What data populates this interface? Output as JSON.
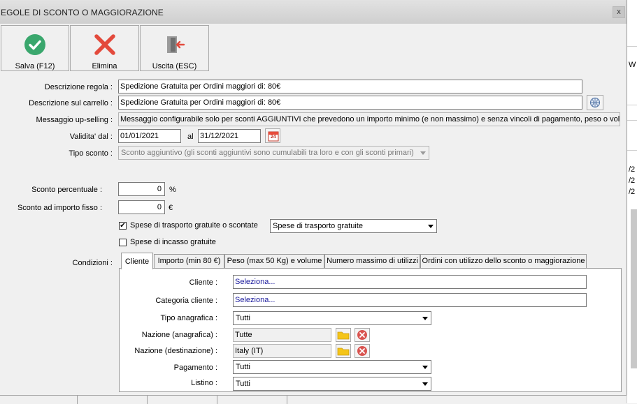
{
  "window": {
    "title": "EGOLE DI SCONTO O MAGGIORAZIONE",
    "close_label": "x"
  },
  "toolbar": {
    "save_label": "Salva (F12)",
    "delete_label": "Elimina",
    "exit_label": "Uscita (ESC)"
  },
  "form": {
    "descrizione_regola_label": "Descrizione regola :",
    "descrizione_regola_value": "Spedizione Gratuita per Ordini maggiori di: 80€",
    "descrizione_carrello_label": "Descrizione sul carrello :",
    "descrizione_carrello_value": "Spedizione Gratuita per Ordini maggiori di: 80€",
    "upselling_label": "Messaggio up-selling :",
    "upselling_value": "Messaggio configurabile solo per sconti AGGIUNTIVI che prevedono un importo minimo (e non massimo) e senza vincoli di pagamento, peso o volume",
    "validita_label": "Validita' dal :",
    "validita_dal": "01/01/2021",
    "validita_al_label": "al",
    "validita_al": "31/12/2021",
    "calendar_day": "24",
    "tipo_sconto_label": "Tipo sconto :",
    "tipo_sconto_value": "Sconto aggiuntivo (gli sconti aggiuntivi sono cumulabili tra loro e con gli sconti primari)",
    "sconto_percentuale_label": "Sconto percentuale :",
    "sconto_percentuale_value": "0",
    "sconto_percentuale_unit": "%",
    "sconto_importo_label": "Sconto ad importo fisso :",
    "sconto_importo_value": "0",
    "sconto_importo_unit": "€",
    "spese_trasporto_label": "Spese di trasporto gratuite o scontate",
    "spese_trasporto_checked": "✔",
    "spese_trasporto_option": "Spese di trasporto gratuite",
    "spese_incasso_label": "Spese di incasso gratuite",
    "condizioni_label": "Condizioni :"
  },
  "tabs": [
    {
      "label": "Cliente"
    },
    {
      "label": "Importo (min 80 €)"
    },
    {
      "label": "Peso (max 50 Kg) e volume"
    },
    {
      "label": "Numero massimo di utilizzi"
    },
    {
      "label": "Ordini con utilizzo dello sconto o maggiorazione"
    }
  ],
  "cliente_tab": {
    "cliente_label": "Cliente :",
    "cliente_value": "Seleziona...",
    "categoria_label": "Categoria cliente :",
    "categoria_value": "Seleziona...",
    "tipo_anagrafica_label": "Tipo anagrafica :",
    "tipo_anagrafica_value": "Tutti",
    "nazione_anagrafica_label": "Nazione (anagrafica) :",
    "nazione_anagrafica_value": "Tutte",
    "nazione_destinazione_label": "Nazione (destinazione) :",
    "nazione_destinazione_value": "Italy (IT)",
    "pagamento_label": "Pagamento :",
    "pagamento_value": "Tutti",
    "listino_label": "Listino :",
    "listino_value": "Tutti"
  },
  "background": {
    "fragment_w": "W",
    "fragment_1": "/2",
    "fragment_2": "/2",
    "fragment_3": "/2"
  },
  "colors": {
    "save_green": "#3aa76d",
    "delete_red": "#e34a3c",
    "clear_red": "#d9534f",
    "folder_yellow": "#f5c518"
  }
}
